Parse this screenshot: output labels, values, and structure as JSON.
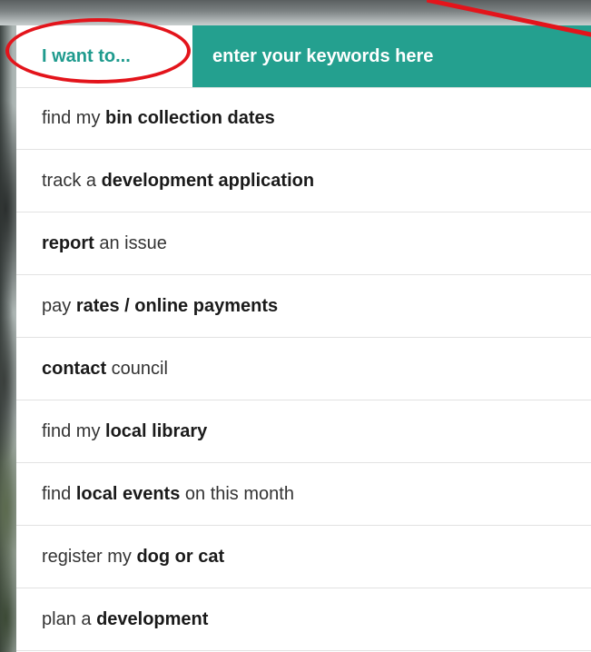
{
  "search": {
    "label": "I want to...",
    "placeholder": "enter your keywords here"
  },
  "menu": {
    "items": [
      {
        "pre": "find my ",
        "bold": "bin collection dates",
        "post": ""
      },
      {
        "pre": "track a ",
        "bold": "development application",
        "post": ""
      },
      {
        "pre": "",
        "bold": "report",
        "post": " an issue"
      },
      {
        "pre": "pay ",
        "bold": "rates / online payments",
        "post": ""
      },
      {
        "pre": "",
        "bold": "contact",
        "post": " council"
      },
      {
        "pre": "find my ",
        "bold": "local library",
        "post": ""
      },
      {
        "pre": "find ",
        "bold": "local events",
        "post": " on this month"
      },
      {
        "pre": "register my ",
        "bold": "dog or cat",
        "post": ""
      },
      {
        "pre": "plan a ",
        "bold": "development",
        "post": ""
      }
    ]
  },
  "colors": {
    "accent": "#24a08f",
    "label_text": "#1f9b8e",
    "annotation": "#e3141b"
  }
}
